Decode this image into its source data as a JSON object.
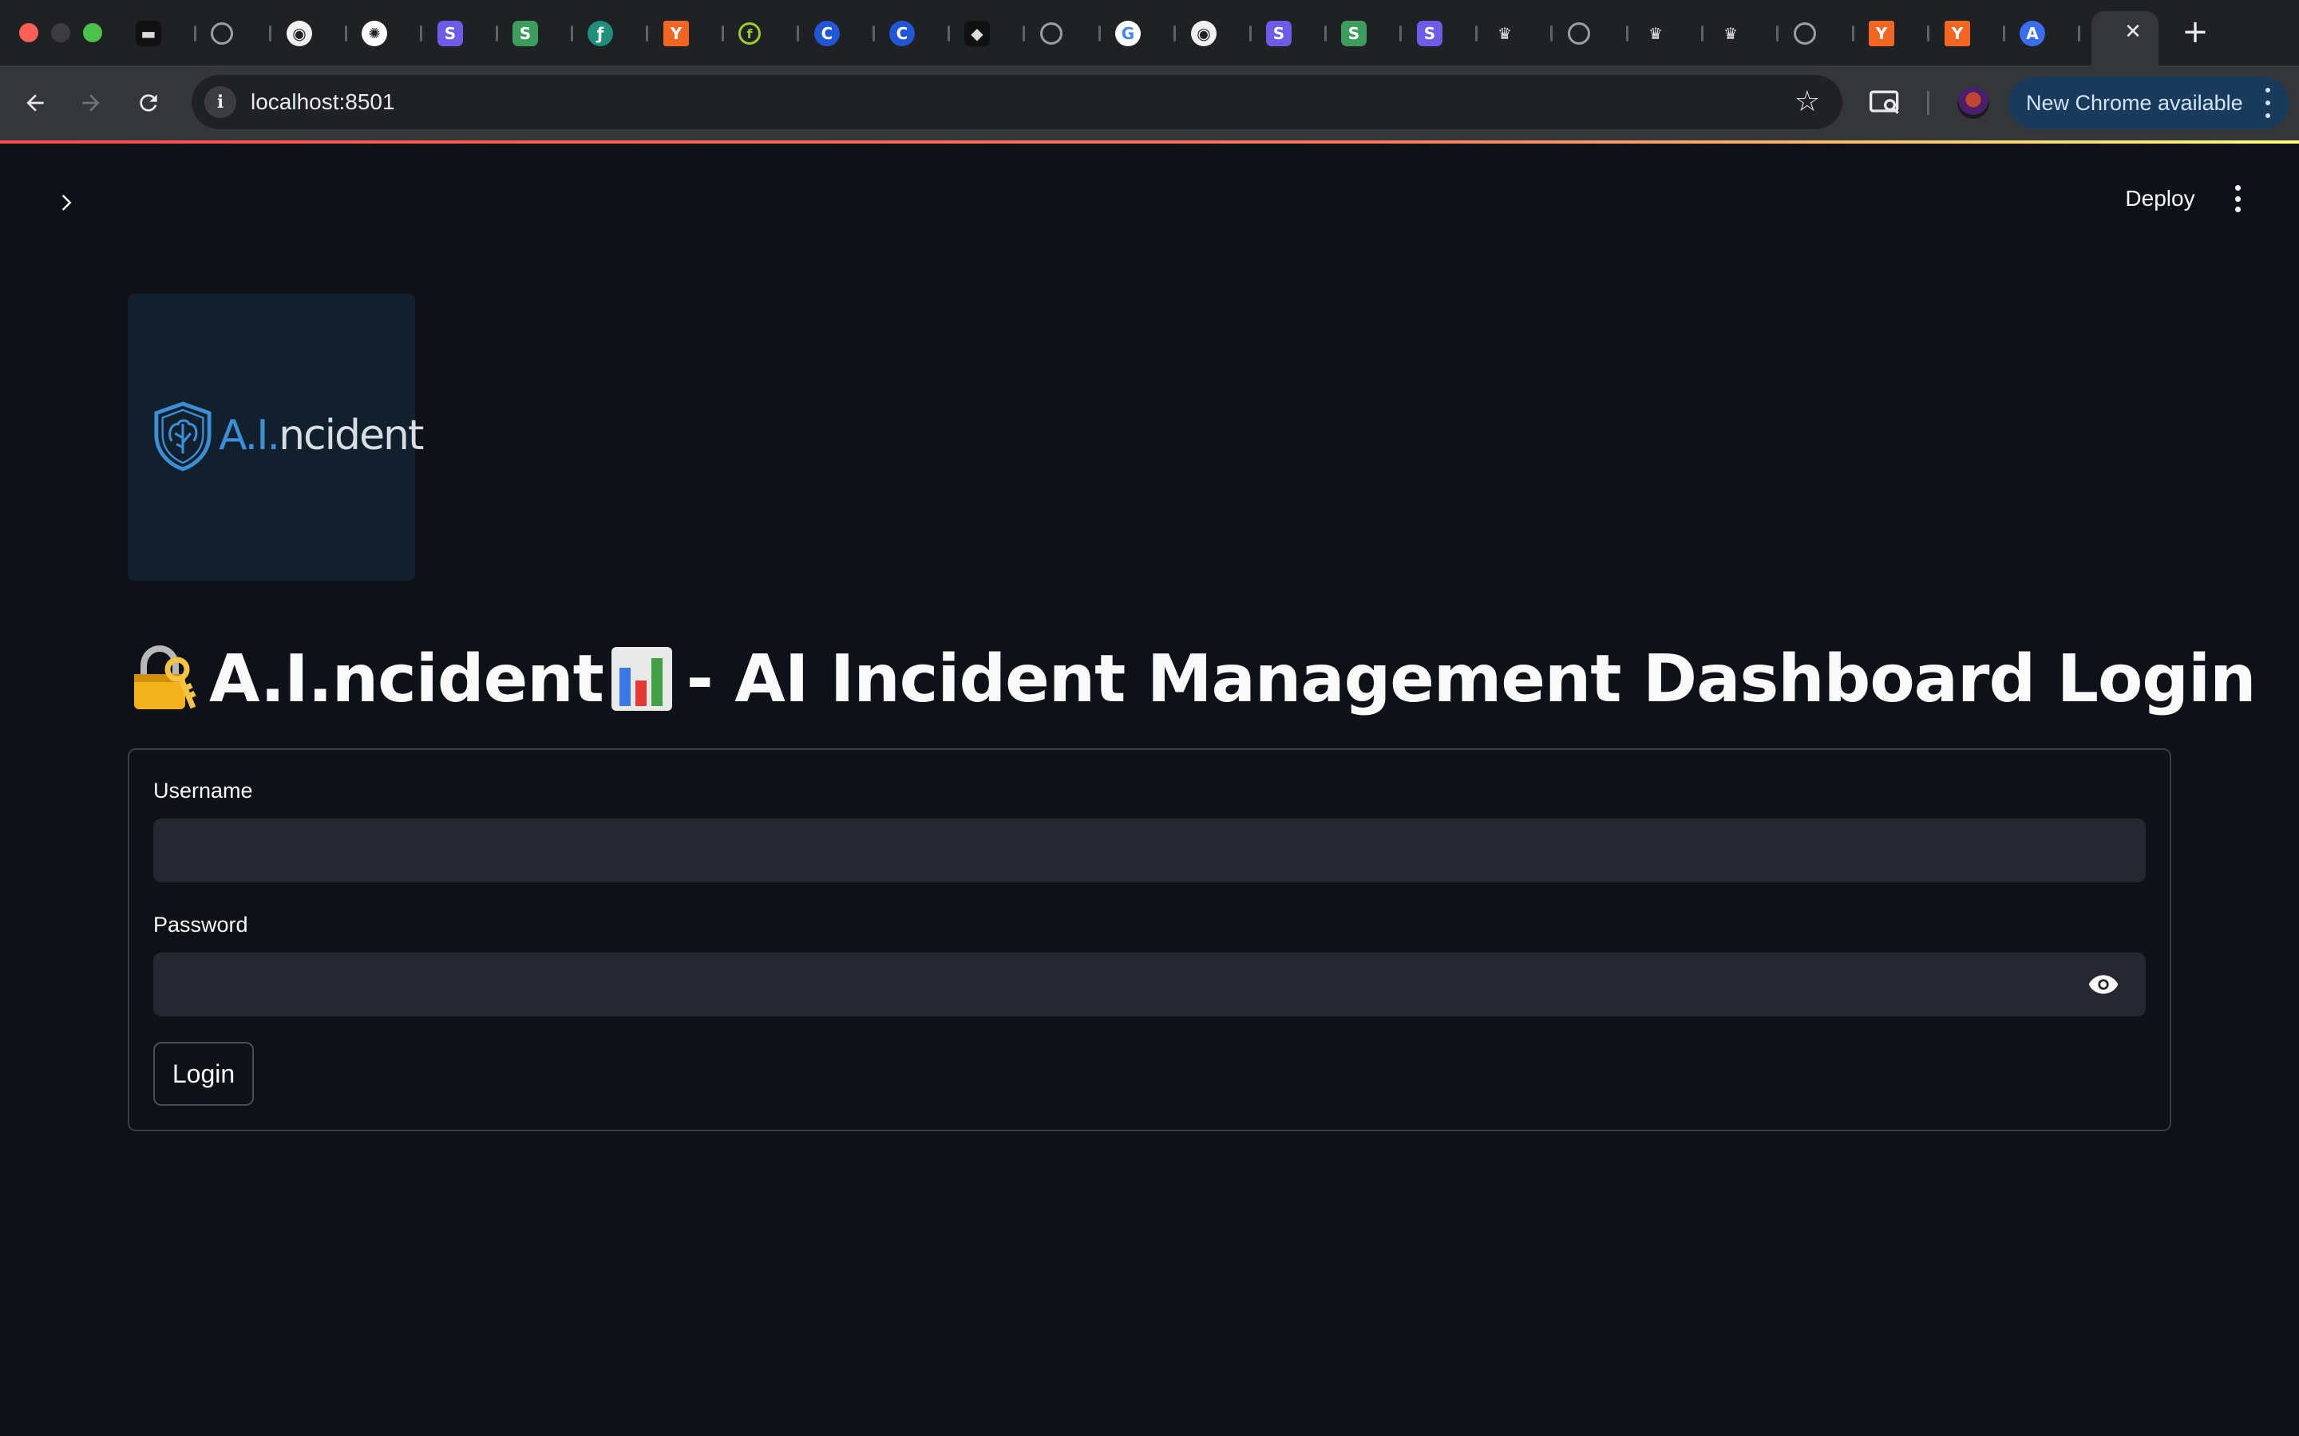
{
  "browser": {
    "url": "localhost:8501",
    "update_label": "New Chrome available",
    "tabs": [
      {
        "icon": "card-icon",
        "glyph": "▬",
        "class": "cube"
      },
      {
        "icon": "globe-icon",
        "glyph": "",
        "class": "globe"
      },
      {
        "icon": "github-icon",
        "glyph": "◉",
        "class": "gh"
      },
      {
        "icon": "openai-icon",
        "glyph": "✺",
        "class": "gpt"
      },
      {
        "icon": "s-purple-icon",
        "glyph": "S",
        "class": "s-purple"
      },
      {
        "icon": "s-green-icon",
        "glyph": "S",
        "class": "s-green"
      },
      {
        "icon": "feather-icon",
        "glyph": "ƒ",
        "class": "feather"
      },
      {
        "icon": "y-combinator-icon",
        "glyph": "Y",
        "class": "y"
      },
      {
        "icon": "leaf-icon",
        "glyph": "f",
        "class": "leaf"
      },
      {
        "icon": "c-blue-icon",
        "glyph": "C",
        "class": "c-blue"
      },
      {
        "icon": "c-blue-icon",
        "glyph": "C",
        "class": "c-blue"
      },
      {
        "icon": "cube-icon",
        "glyph": "◆",
        "class": "cube"
      },
      {
        "icon": "globe-icon",
        "glyph": "",
        "class": "globe"
      },
      {
        "icon": "google-icon",
        "glyph": "G",
        "class": "g"
      },
      {
        "icon": "github-icon",
        "glyph": "◉",
        "class": "gh"
      },
      {
        "icon": "s-purple-icon",
        "glyph": "S",
        "class": "s-purple"
      },
      {
        "icon": "s-green-icon",
        "glyph": "S",
        "class": "s-green"
      },
      {
        "icon": "s-purple-icon",
        "glyph": "S",
        "class": "s-purple"
      },
      {
        "icon": "crown-icon",
        "glyph": "♛",
        "class": "crown"
      },
      {
        "icon": "globe-icon",
        "glyph": "",
        "class": "globe"
      },
      {
        "icon": "crown-icon",
        "glyph": "♛",
        "class": "crown"
      },
      {
        "icon": "crown-icon",
        "glyph": "♛",
        "class": "crown"
      },
      {
        "icon": "globe-icon",
        "glyph": "",
        "class": "globe"
      },
      {
        "icon": "y-combinator-icon",
        "glyph": "Y",
        "class": "y"
      },
      {
        "icon": "y-combinator-icon",
        "glyph": "Y",
        "class": "y"
      },
      {
        "icon": "app-store-icon",
        "glyph": "A",
        "class": "a-blue"
      }
    ]
  },
  "app": {
    "deploy_label": "Deploy",
    "logo_text_a": "A.I.",
    "logo_text_b": "ncident",
    "title": "A.I.ncident",
    "title_rest": " - AI Incident Management Dashboard Login",
    "form": {
      "username_label": "Username",
      "username_value": "",
      "password_label": "Password",
      "password_value": "",
      "login_label": "Login"
    }
  },
  "colors": {
    "background": "#0e1117",
    "input": "#262730",
    "accent_start": "#ff4b4b",
    "accent_end": "#fffd80"
  }
}
